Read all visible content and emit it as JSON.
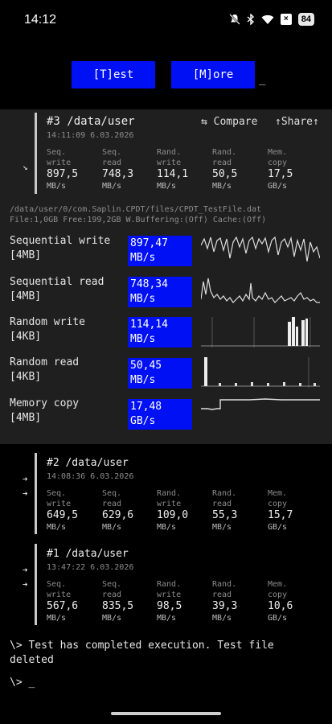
{
  "status_bar": {
    "time": "14:12",
    "battery": "84",
    "icons": [
      "dnd-off-icon",
      "bluetooth-icon",
      "wifi-icon",
      "x-notification-icon",
      "battery-icon"
    ]
  },
  "toolbar": {
    "test_label": "[T]est",
    "more_label": "[M]ore",
    "cursor": "_"
  },
  "current": {
    "title": "#3 /data/user",
    "date": "14:11:09 6.03.2026",
    "compare_label": "⇆ Compare",
    "share_label": "↑Share↑",
    "arrow": "↘",
    "metrics": [
      {
        "label1": "Seq.",
        "label2": "write",
        "value": "897,5",
        "unit": "MB/s"
      },
      {
        "label1": "Seq.",
        "label2": "read",
        "value": "748,3",
        "unit": "MB/s"
      },
      {
        "label1": "Rand.",
        "label2": "write",
        "value": "114,1",
        "unit": "MB/s"
      },
      {
        "label1": "Rand.",
        "label2": "read",
        "value": "50,5",
        "unit": "MB/s"
      },
      {
        "label1": "Mem.",
        "label2": "copy",
        "value": "17,5",
        "unit": "GB/s"
      }
    ],
    "path": "/data/user/0/com.Saplin.CPDT/files/CPDT_TestFile.dat",
    "file_info": "File:1,0GB Free:199,2GB W.Buffering:(Off) Cache:(Off)",
    "benchmarks": [
      {
        "name": "Sequential write",
        "block": "[4MB]",
        "value": "897,47",
        "unit": "MB/s"
      },
      {
        "name": "Sequential read",
        "block": "[4MB]",
        "value": "748,34",
        "unit": "MB/s"
      },
      {
        "name": "Random write",
        "block": "[4KB]",
        "value": "114,14",
        "unit": "MB/s"
      },
      {
        "name": "Random read",
        "block": "[4KB]",
        "value": "50,45",
        "unit": "MB/s"
      },
      {
        "name": "Memory copy",
        "block": "[4MB]",
        "value": "17,48",
        "unit": "GB/s"
      }
    ]
  },
  "history": [
    {
      "title": "#2 /data/user",
      "date": "14:08:36 6.03.2026",
      "arrows": [
        "➔",
        "➔"
      ],
      "metrics": [
        {
          "label1": "Seq.",
          "label2": "write",
          "value": "649,5",
          "unit": "MB/s"
        },
        {
          "label1": "Seq.",
          "label2": "read",
          "value": "629,6",
          "unit": "MB/s"
        },
        {
          "label1": "Rand.",
          "label2": "write",
          "value": "109,0",
          "unit": "MB/s"
        },
        {
          "label1": "Rand.",
          "label2": "read",
          "value": "55,3",
          "unit": "MB/s"
        },
        {
          "label1": "Mem.",
          "label2": "copy",
          "value": "15,7",
          "unit": "GB/s"
        }
      ]
    },
    {
      "title": "#1 /data/user",
      "date": "13:47:22 6.03.2026",
      "arrows": [
        "➔",
        "➔"
      ],
      "metrics": [
        {
          "label1": "Seq.",
          "label2": "write",
          "value": "567,6",
          "unit": "MB/s"
        },
        {
          "label1": "Seq.",
          "label2": "read",
          "value": "835,5",
          "unit": "MB/s"
        },
        {
          "label1": "Rand.",
          "label2": "write",
          "value": "98,5",
          "unit": "MB/s"
        },
        {
          "label1": "Rand.",
          "label2": "read",
          "value": "39,3",
          "unit": "MB/s"
        },
        {
          "label1": "Mem.",
          "label2": "copy",
          "value": "10,6",
          "unit": "GB/s"
        }
      ]
    }
  ],
  "console": {
    "line1": "\\> Test has completed execution. Test file",
    "line2": "deleted",
    "prompt": "\\> _"
  }
}
